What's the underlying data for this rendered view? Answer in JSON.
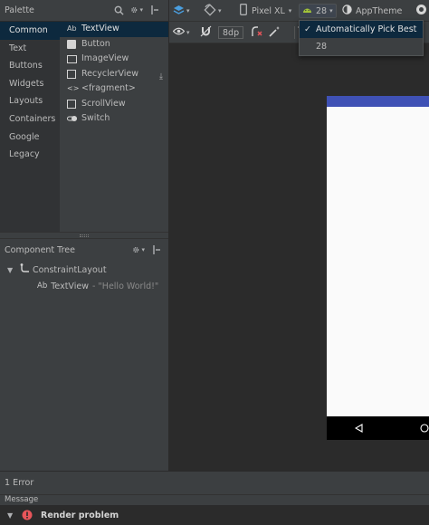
{
  "palette": {
    "title": "Palette",
    "categories": [
      "Common",
      "Text",
      "Buttons",
      "Widgets",
      "Layouts",
      "Containers",
      "Google",
      "Legacy"
    ],
    "widgets": [
      {
        "icon_text": "Ab",
        "label": "TextView"
      },
      {
        "icon_text": "",
        "label": "Button"
      },
      {
        "icon_text": "",
        "label": "ImageView"
      },
      {
        "icon_text": "",
        "label": "RecyclerView"
      },
      {
        "icon_text": "<>",
        "label": "<fragment>"
      },
      {
        "icon_text": "",
        "label": "ScrollView"
      },
      {
        "icon_text": "",
        "label": "Switch"
      }
    ]
  },
  "component_tree": {
    "title": "Component Tree",
    "root": "ConstraintLayout",
    "child_icon_text": "Ab",
    "child_label": "TextView",
    "child_value": "- \"Hello World!\""
  },
  "toolbar": {
    "device": "Pixel XL",
    "api": "28",
    "theme": "AppTheme",
    "margin": "8dp"
  },
  "api_dropdown": {
    "items": [
      "Automatically Pick Best",
      "28"
    ],
    "checkmark": "✓"
  },
  "bottom": {
    "errors": "1 Error",
    "message_header": "Message",
    "render_problem": "Render problem"
  },
  "colors": {
    "selection": "#0d293e",
    "status_bar": "#3f51b5",
    "error": "#e8555a",
    "api_icon": "#a4c639"
  },
  "icons": [
    "search-icon",
    "gear-icon",
    "pin-icon",
    "layers-icon",
    "rotate-icon",
    "phone-icon",
    "android-icon",
    "theme-icon",
    "eye-icon",
    "magnet-icon",
    "clear-constraints-icon",
    "magic-wand-icon",
    "download-icon",
    "back-nav-icon",
    "home-nav-icon",
    "error-icon"
  ]
}
